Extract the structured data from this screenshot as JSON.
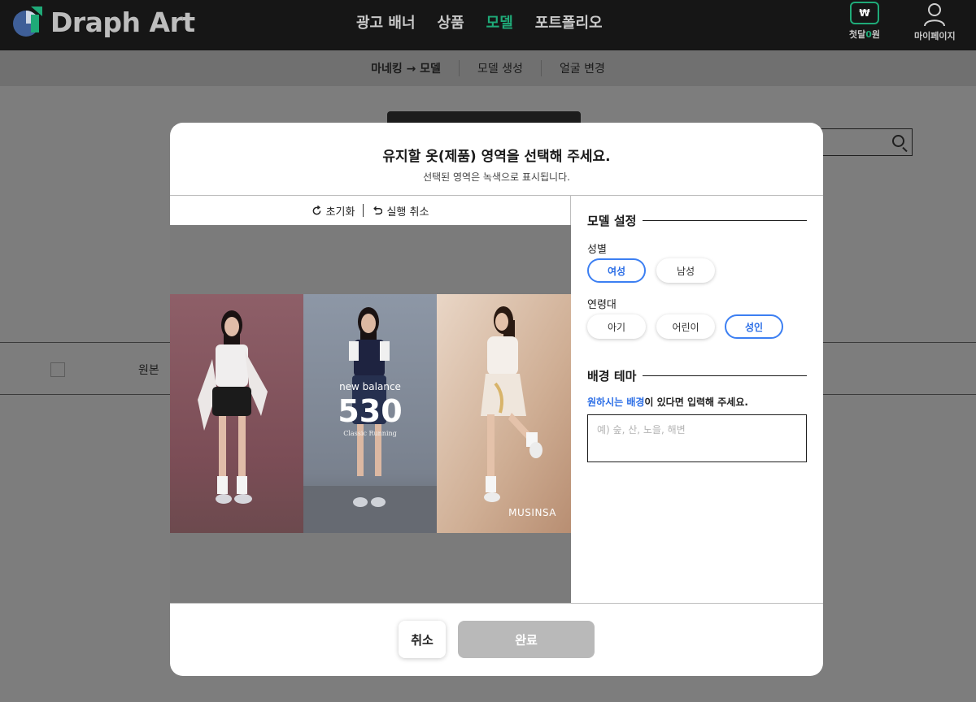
{
  "app": {
    "brand": "Draph Art"
  },
  "topnav": {
    "items": [
      "광고 배너",
      "상품",
      "모델",
      "포트폴리오"
    ],
    "active_index": 2,
    "credits": {
      "icon": "won-icon",
      "symbol": "₩",
      "label_prefix": "첫달",
      "label_value": "0",
      "label_suffix": "원"
    },
    "mypage": {
      "icon": "user-icon",
      "label": "마이페이지"
    }
  },
  "subnav": {
    "items": [
      "마네킹 → 모델",
      "모델 생성",
      "얼굴 변경"
    ],
    "active_index": 0
  },
  "background_page": {
    "original_label": "원본"
  },
  "modal": {
    "title": "유지할 옷(제품) 영역을 선택해 주세요.",
    "subtitle": "선택된 영역은 녹색으로 표시됩니다.",
    "tools": {
      "reset": "초기화",
      "undo": "실행 취소"
    },
    "image": {
      "brand_text": "new balance",
      "model_number": "530",
      "tagline": "Classic Running",
      "store_text": "MUSINSA"
    },
    "settings": {
      "title": "모델 설정",
      "gender_label": "성별",
      "gender_options": [
        "여성",
        "남성"
      ],
      "gender_selected": "여성",
      "age_label": "연령대",
      "age_options": [
        "아기",
        "어린이",
        "성인"
      ],
      "age_selected": "성인"
    },
    "theme": {
      "title": "배경 테마",
      "hint_highlight": "원하시는 배경",
      "hint_rest": "이 있다면 입력해 주세요.",
      "placeholder": "예) 숲, 산, 노을, 해변",
      "value": ""
    },
    "footer": {
      "cancel": "취소",
      "done": "완료"
    }
  },
  "colors": {
    "accent_green": "#1faa78",
    "select_blue": "#3c7ff2",
    "disabled_gray": "#b9b9b9"
  }
}
